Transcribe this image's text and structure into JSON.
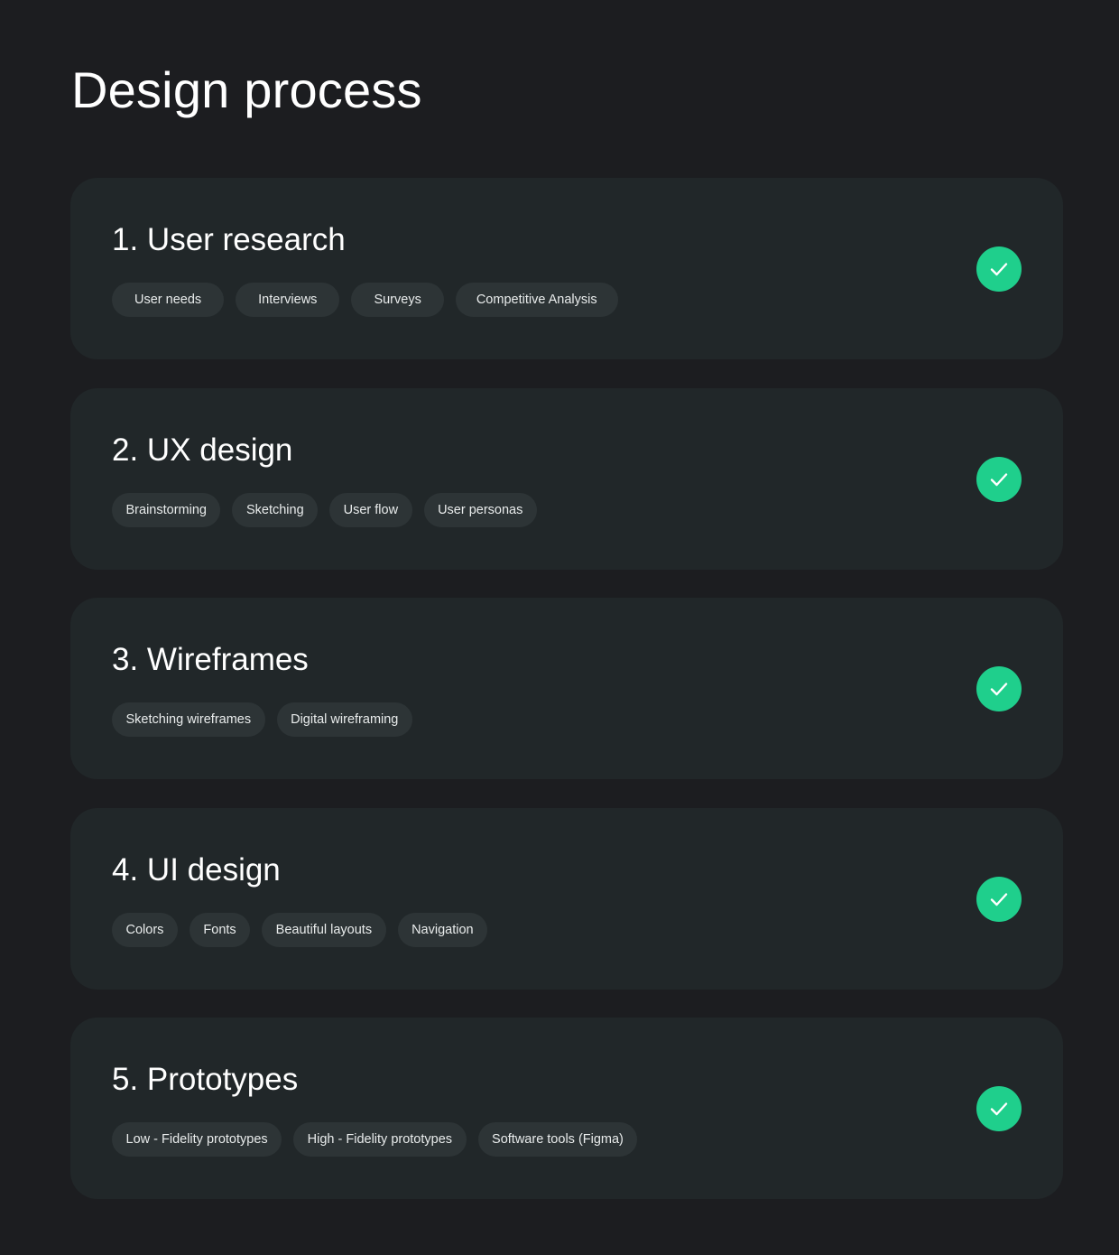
{
  "page": {
    "title": "Design process"
  },
  "colors": {
    "background": "#1c1d20",
    "card": "#212729",
    "tag": "#2d3436",
    "accent": "#1fcf8c",
    "text": "#ffffff"
  },
  "steps": [
    {
      "title": "1. User research",
      "status_icon": "check-icon",
      "tags": [
        "User needs",
        "Interviews",
        "Surveys",
        "Competitive Analysis"
      ]
    },
    {
      "title": "2. UX design",
      "status_icon": "check-icon",
      "tags": [
        "Brainstorming",
        "Sketching",
        "User flow",
        "User personas"
      ]
    },
    {
      "title": "3. Wireframes",
      "status_icon": "check-icon",
      "tags": [
        "Sketching wireframes",
        "Digital wireframing"
      ]
    },
    {
      "title": "4. UI design",
      "status_icon": "check-icon",
      "tags": [
        "Colors",
        "Fonts",
        "Beautiful layouts",
        "Navigation"
      ]
    },
    {
      "title": "5. Prototypes",
      "status_icon": "check-icon",
      "tags": [
        "Low - Fidelity prototypes",
        "High - Fidelity prototypes",
        "Software tools (Figma)"
      ]
    }
  ]
}
